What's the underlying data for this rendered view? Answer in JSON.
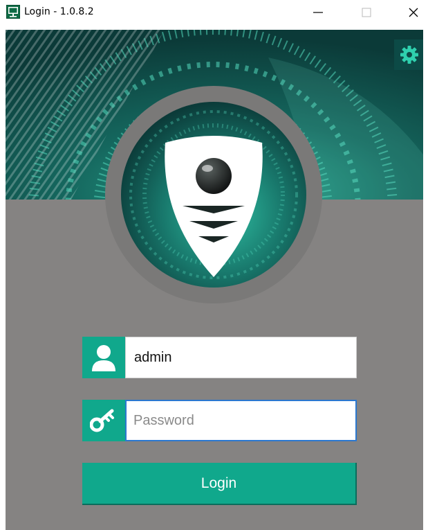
{
  "window": {
    "title": "Login - 1.0.8.2",
    "app_icon": "monitor-app-icon",
    "controls": [
      "minimize-icon",
      "maximize-icon",
      "close-icon"
    ]
  },
  "settings": {
    "icon": "gear-icon"
  },
  "username": {
    "icon": "user-icon",
    "value": "admin"
  },
  "password": {
    "icon": "key-icon",
    "value": "",
    "placeholder": "Password"
  },
  "login_button": {
    "label": "Login"
  },
  "colors": {
    "accent": "#10a88c",
    "panel": "#858382",
    "focus_border": "#2b78d0",
    "banner_dark": "#0b3f3c"
  }
}
